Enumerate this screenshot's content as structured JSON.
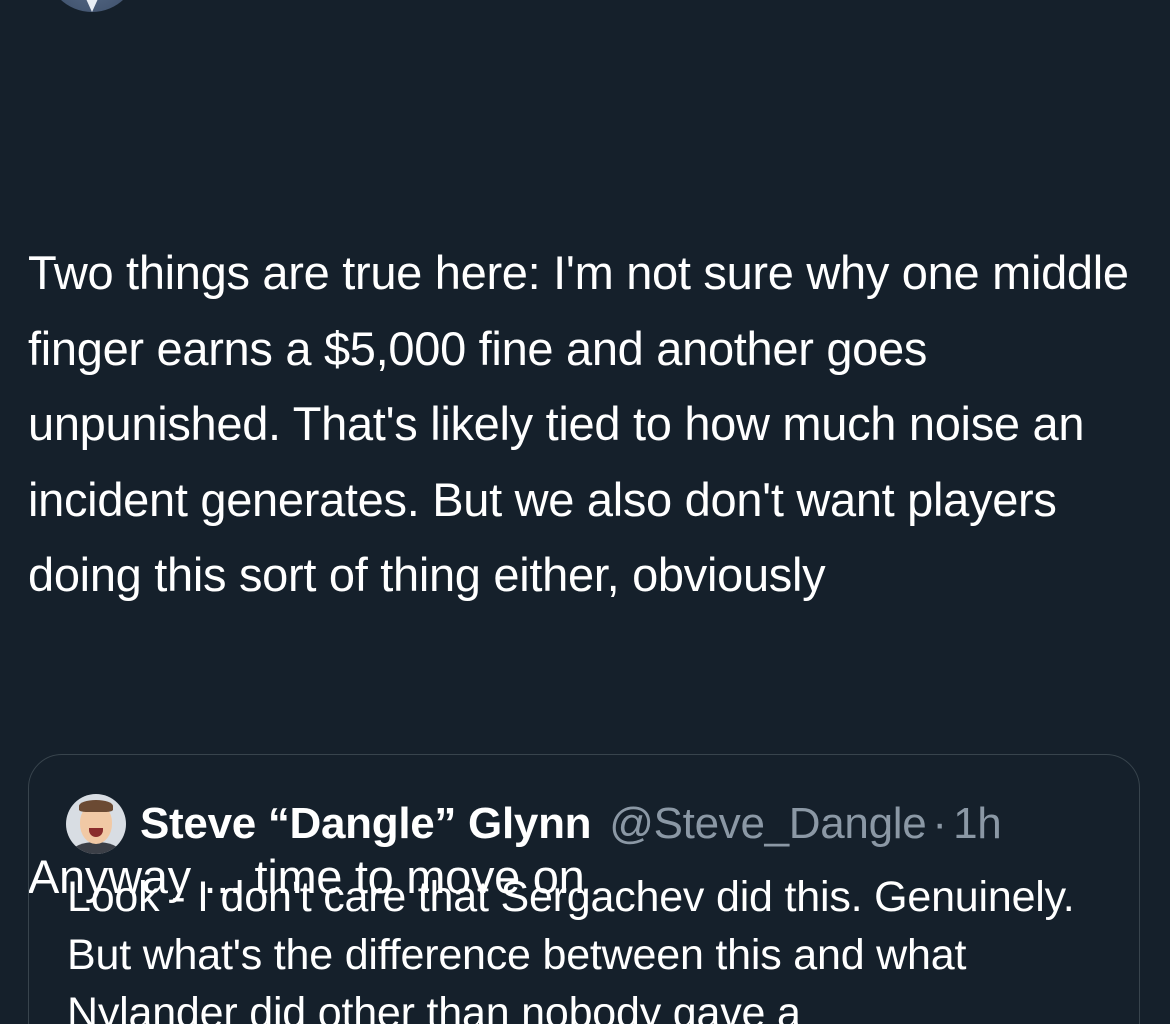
{
  "tweet": {
    "text_paragraph_1": "Two things are true here: I'm not sure why one middle finger earns a $5,000 fine and another goes unpunished. That's likely tied to how much noise an incident generates. But we also don't want players doing this sort of thing either, obviously",
    "text_paragraph_2": "Anyway ... time to move on"
  },
  "quoted_tweet": {
    "display_name": "Steve “Dangle” Glynn",
    "handle": "@Steve_Dangle",
    "separator": "·",
    "time": "1h",
    "text": "Look - I don't care that Sergachev did this. Genuinely. But what's the difference between this and what Nylander did other than nobody gave a"
  },
  "icons": {
    "top_avatar": "author-avatar",
    "quote_avatar": "quoted-author-avatar"
  },
  "colors": {
    "background": "#15202b",
    "text_primary": "#ffffff",
    "text_secondary": "#8b98a5",
    "card_border": "#38444d"
  }
}
